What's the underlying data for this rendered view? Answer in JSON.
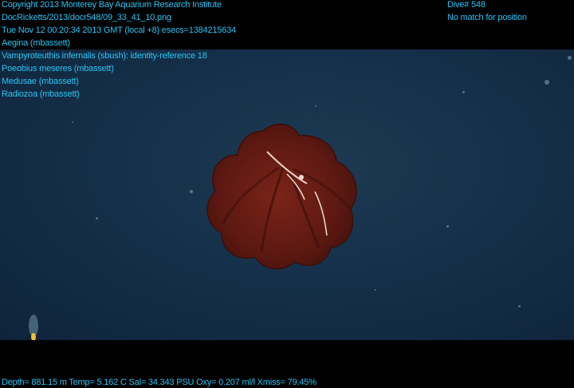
{
  "header": {
    "copyright": "Copyright 2013 Monterey Bay Aquarium Research Institute",
    "file_path": "DocRicketts/2013/docr548/09_33_41_10.png",
    "timestamp": "Tue Nov 12 00:20:34 2013 GMT (local +8)  esecs=1384215634",
    "dive": "Dive# 548",
    "position_status": "No match for position"
  },
  "annotations": [
    "Aegina (mbassett)",
    "Vampyroteuthis infernalis (sbush): identity-reference 18",
    "Poeobius meseres (mbassett)",
    "Medusae (mbassett)",
    "Radiozoa (mbassett)"
  ],
  "footer": {
    "telemetry": "Depth= 881.15 m  Temp= 5.162 C  Sal= 34.343 PSU  Oxy= 0.207 ml/l  Xmiss= 79.45%"
  },
  "colors": {
    "overlay_text": "#27c4f5",
    "water": "#15304a",
    "animal": "#6e1d14"
  }
}
